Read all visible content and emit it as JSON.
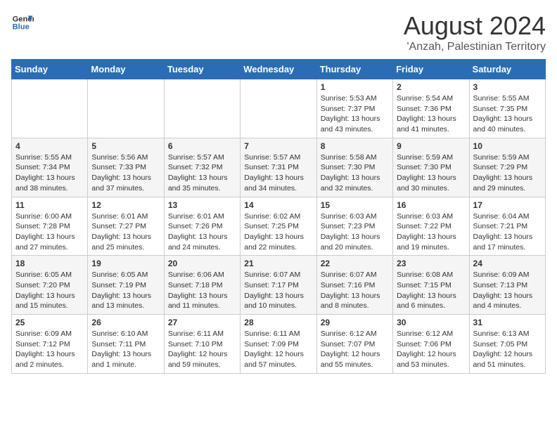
{
  "header": {
    "logo_line1": "General",
    "logo_line2": "Blue",
    "title": "August 2024",
    "subtitle": "'Anzah, Palestinian Territory"
  },
  "weekdays": [
    "Sunday",
    "Monday",
    "Tuesday",
    "Wednesday",
    "Thursday",
    "Friday",
    "Saturday"
  ],
  "weeks": [
    [
      {
        "day": "",
        "info": ""
      },
      {
        "day": "",
        "info": ""
      },
      {
        "day": "",
        "info": ""
      },
      {
        "day": "",
        "info": ""
      },
      {
        "day": "1",
        "info": "Sunrise: 5:53 AM\nSunset: 7:37 PM\nDaylight: 13 hours\nand 43 minutes."
      },
      {
        "day": "2",
        "info": "Sunrise: 5:54 AM\nSunset: 7:36 PM\nDaylight: 13 hours\nand 41 minutes."
      },
      {
        "day": "3",
        "info": "Sunrise: 5:55 AM\nSunset: 7:35 PM\nDaylight: 13 hours\nand 40 minutes."
      }
    ],
    [
      {
        "day": "4",
        "info": "Sunrise: 5:55 AM\nSunset: 7:34 PM\nDaylight: 13 hours\nand 38 minutes."
      },
      {
        "day": "5",
        "info": "Sunrise: 5:56 AM\nSunset: 7:33 PM\nDaylight: 13 hours\nand 37 minutes."
      },
      {
        "day": "6",
        "info": "Sunrise: 5:57 AM\nSunset: 7:32 PM\nDaylight: 13 hours\nand 35 minutes."
      },
      {
        "day": "7",
        "info": "Sunrise: 5:57 AM\nSunset: 7:31 PM\nDaylight: 13 hours\nand 34 minutes."
      },
      {
        "day": "8",
        "info": "Sunrise: 5:58 AM\nSunset: 7:30 PM\nDaylight: 13 hours\nand 32 minutes."
      },
      {
        "day": "9",
        "info": "Sunrise: 5:59 AM\nSunset: 7:30 PM\nDaylight: 13 hours\nand 30 minutes."
      },
      {
        "day": "10",
        "info": "Sunrise: 5:59 AM\nSunset: 7:29 PM\nDaylight: 13 hours\nand 29 minutes."
      }
    ],
    [
      {
        "day": "11",
        "info": "Sunrise: 6:00 AM\nSunset: 7:28 PM\nDaylight: 13 hours\nand 27 minutes."
      },
      {
        "day": "12",
        "info": "Sunrise: 6:01 AM\nSunset: 7:27 PM\nDaylight: 13 hours\nand 25 minutes."
      },
      {
        "day": "13",
        "info": "Sunrise: 6:01 AM\nSunset: 7:26 PM\nDaylight: 13 hours\nand 24 minutes."
      },
      {
        "day": "14",
        "info": "Sunrise: 6:02 AM\nSunset: 7:25 PM\nDaylight: 13 hours\nand 22 minutes."
      },
      {
        "day": "15",
        "info": "Sunrise: 6:03 AM\nSunset: 7:23 PM\nDaylight: 13 hours\nand 20 minutes."
      },
      {
        "day": "16",
        "info": "Sunrise: 6:03 AM\nSunset: 7:22 PM\nDaylight: 13 hours\nand 19 minutes."
      },
      {
        "day": "17",
        "info": "Sunrise: 6:04 AM\nSunset: 7:21 PM\nDaylight: 13 hours\nand 17 minutes."
      }
    ],
    [
      {
        "day": "18",
        "info": "Sunrise: 6:05 AM\nSunset: 7:20 PM\nDaylight: 13 hours\nand 15 minutes."
      },
      {
        "day": "19",
        "info": "Sunrise: 6:05 AM\nSunset: 7:19 PM\nDaylight: 13 hours\nand 13 minutes."
      },
      {
        "day": "20",
        "info": "Sunrise: 6:06 AM\nSunset: 7:18 PM\nDaylight: 13 hours\nand 11 minutes."
      },
      {
        "day": "21",
        "info": "Sunrise: 6:07 AM\nSunset: 7:17 PM\nDaylight: 13 hours\nand 10 minutes."
      },
      {
        "day": "22",
        "info": "Sunrise: 6:07 AM\nSunset: 7:16 PM\nDaylight: 13 hours\nand 8 minutes."
      },
      {
        "day": "23",
        "info": "Sunrise: 6:08 AM\nSunset: 7:15 PM\nDaylight: 13 hours\nand 6 minutes."
      },
      {
        "day": "24",
        "info": "Sunrise: 6:09 AM\nSunset: 7:13 PM\nDaylight: 13 hours\nand 4 minutes."
      }
    ],
    [
      {
        "day": "25",
        "info": "Sunrise: 6:09 AM\nSunset: 7:12 PM\nDaylight: 13 hours\nand 2 minutes."
      },
      {
        "day": "26",
        "info": "Sunrise: 6:10 AM\nSunset: 7:11 PM\nDaylight: 13 hours\nand 1 minute."
      },
      {
        "day": "27",
        "info": "Sunrise: 6:11 AM\nSunset: 7:10 PM\nDaylight: 12 hours\nand 59 minutes."
      },
      {
        "day": "28",
        "info": "Sunrise: 6:11 AM\nSunset: 7:09 PM\nDaylight: 12 hours\nand 57 minutes."
      },
      {
        "day": "29",
        "info": "Sunrise: 6:12 AM\nSunset: 7:07 PM\nDaylight: 12 hours\nand 55 minutes."
      },
      {
        "day": "30",
        "info": "Sunrise: 6:12 AM\nSunset: 7:06 PM\nDaylight: 12 hours\nand 53 minutes."
      },
      {
        "day": "31",
        "info": "Sunrise: 6:13 AM\nSunset: 7:05 PM\nDaylight: 12 hours\nand 51 minutes."
      }
    ]
  ]
}
